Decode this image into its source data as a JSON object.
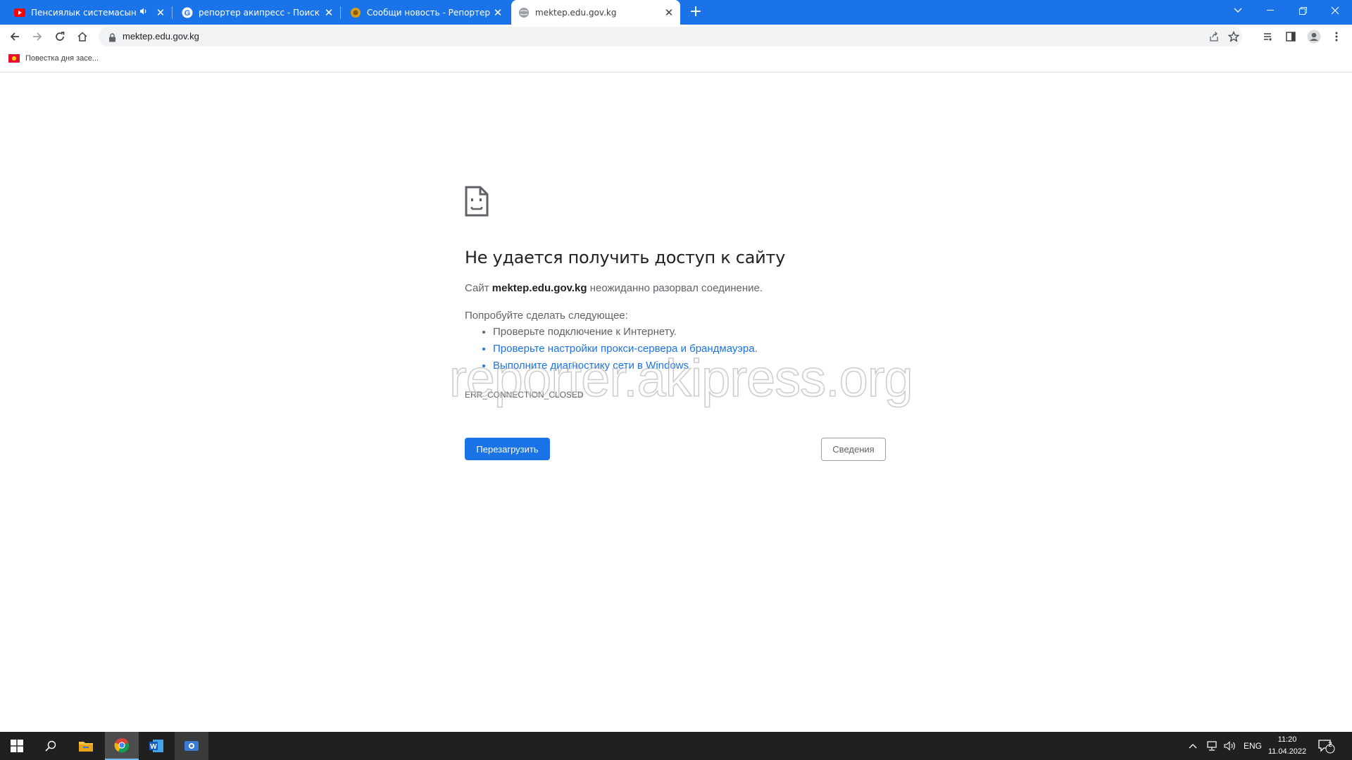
{
  "tabs": [
    {
      "title": "Пенсиялык системасын ре",
      "icon": "youtube-icon",
      "muted_icon": "speaker-icon"
    },
    {
      "title": "репортер акипресс - Поиск в G",
      "icon": "google-icon"
    },
    {
      "title": "Сообщи новость - Репортер",
      "icon": "reporter-icon"
    },
    {
      "title": "mektep.edu.gov.kg",
      "icon": "globe-icon",
      "active": true
    }
  ],
  "address_bar": {
    "url": "mektep.edu.gov.kg"
  },
  "bookmarks": [
    {
      "label": "Повестка дня засе..."
    }
  ],
  "error_page": {
    "title": "Не удается получить доступ к сайту",
    "line1_prefix": "Сайт",
    "line1_host": "mektep.edu.gov.kg",
    "line1_suffix": "неожиданно разорвал соединение.",
    "try_heading": "Попробуйте сделать следующее:",
    "suggestions": [
      {
        "text": "Проверьте подключение к Интернету.",
        "link": false
      },
      {
        "text": "Проверьте настройки прокси-сервера и брандмауэра.",
        "link": true
      },
      {
        "text": "Выполните диагностику сети в Windows",
        "link": true
      }
    ],
    "error_code": "ERR_CONNECTION_CLOSED",
    "reload_label": "Перезагрузить",
    "details_label": "Сведения"
  },
  "watermark": "reporter.akipress.org",
  "taskbar": {
    "language": "ENG",
    "time": "11:20",
    "date": "11.04.2022",
    "notifications_count": "2"
  },
  "colors": {
    "tabstrip": "#1a73e8",
    "link": "#1a73e8",
    "button_primary": "#1a73e8",
    "taskbar": "#202020"
  }
}
